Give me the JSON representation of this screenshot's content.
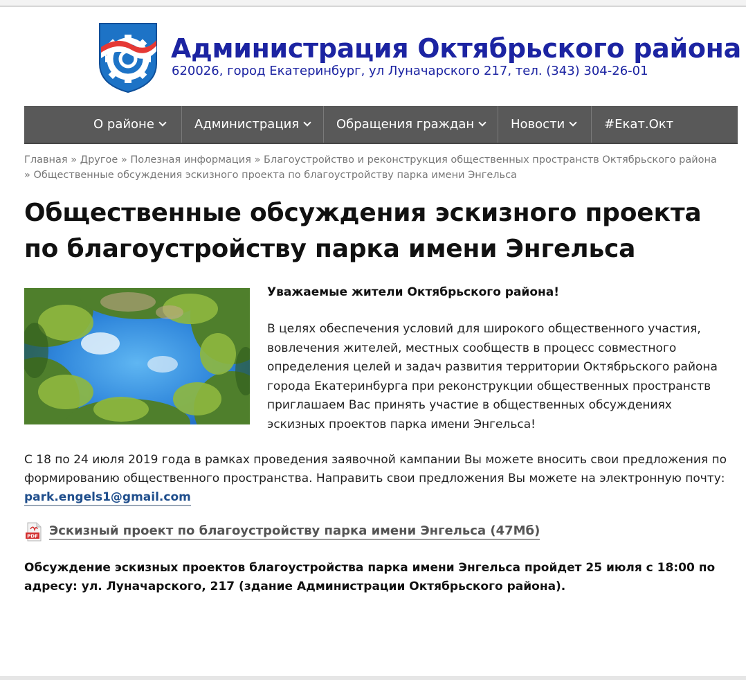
{
  "header": {
    "title": "Администрация Октябрьского района",
    "subtitle": "620026, город Екатеринбург, ул Луначарского 217, тел. (343) 304-26-01"
  },
  "nav": {
    "items": [
      {
        "label": "О районе",
        "dropdown": true
      },
      {
        "label": "Администрация",
        "dropdown": true
      },
      {
        "label": "Обращения граждан",
        "dropdown": true
      },
      {
        "label": "Новости",
        "dropdown": true
      },
      {
        "label": "#Екат.Окт",
        "dropdown": false
      }
    ]
  },
  "breadcrumb": {
    "items": [
      "Главная",
      "Другое",
      "Полезная информация",
      "Благоустройство и реконструкция общественных пространств Октябрьского района",
      "Общественные обсуждения эскизного проекта по благоустройству парка имени Энгельса"
    ],
    "separator": "»"
  },
  "article": {
    "title": "Общественные обсуждения эскизного проекта по благоустройству парка имени Энгельса",
    "greeting": "Уважаемые жители Октябрьского района!",
    "intro": "В целях обеспечения условий для широкого общественного участия, вовлечения жителей, местных сообществ в процесс совместного определения целей и задач развития территории Октябрьского района города Екатеринбурга при реконструкции общественных пространств приглашаем Вас принять участие в общественных обсуждениях эскизных проектов парка имени Энгельса!",
    "proposal_text": "С 18 по 24 июля 2019 года в рамках проведения заявочной кампании Вы можете вносить свои предложения по формированию общественного пространства. Направить свои предложения Вы можете на электронную почту: ",
    "email": "park.engels1@gmail.com",
    "pdf_link": "Эскизный проект по благоустройству парка имени Энгельса (47Мб)",
    "pdf_badge": "PDF",
    "final_notice": "Обсуждение эскизных проектов благоустройства парка имени Энгельса пройдет 25 июля с 18:00 по адресу: ул. Луначарского, 217 (здание Администрации Октябрьского района)."
  },
  "colors": {
    "brand": "#1c24a2",
    "nav_bg": "#595959",
    "link": "#1f4e8c"
  }
}
